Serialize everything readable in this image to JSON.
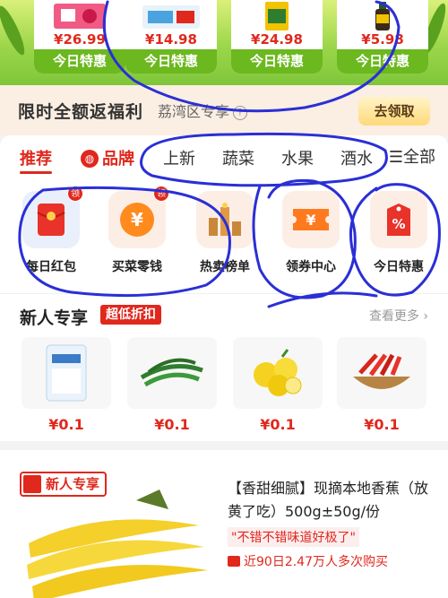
{
  "promo": {
    "cards": [
      {
        "price": "¥26.99",
        "tag": "今日特惠"
      },
      {
        "price": "¥14.98",
        "tag": "今日特惠"
      },
      {
        "price": "¥24.98",
        "tag": "今日特惠"
      },
      {
        "price": "¥5.98",
        "tag": "今日特惠"
      }
    ]
  },
  "benefit": {
    "title": "限时全额返福利",
    "location": "荔湾区专享",
    "help": "?",
    "button": "去领取"
  },
  "tabs": {
    "items": [
      "推荐",
      "品牌",
      "上新",
      "蔬菜",
      "水果",
      "酒水"
    ],
    "brand_icon": "◍",
    "all": "全部",
    "menu_icon": "☰"
  },
  "services": [
    {
      "label": "每日红包",
      "icon": "red-envelope-icon",
      "badge": "领"
    },
    {
      "label": "买菜零钱",
      "icon": "yuan-coin-icon",
      "badge": "领"
    },
    {
      "label": "热卖榜单",
      "icon": "ranking-icon",
      "badge": ""
    },
    {
      "label": "领券中心",
      "icon": "coupon-icon",
      "badge": ""
    },
    {
      "label": "今日特惠",
      "icon": "discount-tag-icon",
      "badge": ""
    }
  ],
  "new_user": {
    "title": "新人专享",
    "badge": "超低折扣",
    "more": "查看更多",
    "chevron": "›",
    "products": [
      {
        "price": "¥0.1"
      },
      {
        "price": "¥0.1"
      },
      {
        "price": "¥0.1"
      },
      {
        "price": "¥0.1"
      }
    ]
  },
  "product_card": {
    "tag": "新人专享",
    "title": "【香甜细腻】现摘本地香蕉（放黄了吃）500g±50g/份",
    "quote": "\"不错不错味道好极了\"",
    "sales": "近90日2.47万人多次购买"
  },
  "colors": {
    "accent": "#e0281d",
    "promo_green": "#6cb81f",
    "annotation_blue": "#2a2fd6"
  }
}
